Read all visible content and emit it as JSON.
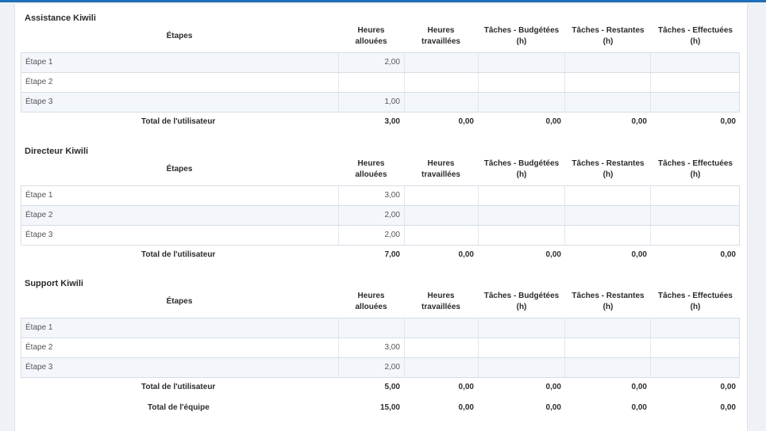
{
  "columns": {
    "etapes": "Étapes",
    "heures_allouees": "Heures\nallouées",
    "heures_travaillees": "Heures\ntravaillées",
    "taches_budgetees": "Tâches - Budgétées\n(h)",
    "taches_restantes": "Tâches - Restantes\n(h)",
    "taches_effectuees": "Tâches - Effectuées\n(h)"
  },
  "sections": [
    {
      "title": "Assistance Kiwili",
      "rows": [
        {
          "etape": "Étape 1",
          "heures_allouees": "2,00",
          "heures_travaillees": "",
          "taches_budgetees": "",
          "taches_restantes": "",
          "taches_effectuees": ""
        },
        {
          "etape": "Étape 2",
          "heures_allouees": "",
          "heures_travaillees": "",
          "taches_budgetees": "",
          "taches_restantes": "",
          "taches_effectuees": ""
        },
        {
          "etape": "Étape 3",
          "heures_allouees": "1,00",
          "heures_travaillees": "",
          "taches_budgetees": "",
          "taches_restantes": "",
          "taches_effectuees": ""
        }
      ],
      "total": {
        "label": "Total de l'utilisateur",
        "heures_allouees": "3,00",
        "heures_travaillees": "0,00",
        "taches_budgetees": "0,00",
        "taches_restantes": "0,00",
        "taches_effectuees": "0,00"
      }
    },
    {
      "title": "Directeur Kiwili",
      "rows": [
        {
          "etape": "Étape 1",
          "heures_allouees": "3,00",
          "heures_travaillees": "",
          "taches_budgetees": "",
          "taches_restantes": "",
          "taches_effectuees": ""
        },
        {
          "etape": "Étape 2",
          "heures_allouees": "2,00",
          "heures_travaillees": "",
          "taches_budgetees": "",
          "taches_restantes": "",
          "taches_effectuees": ""
        },
        {
          "etape": "Étape 3",
          "heures_allouees": "2,00",
          "heures_travaillees": "",
          "taches_budgetees": "",
          "taches_restantes": "",
          "taches_effectuees": ""
        }
      ],
      "total": {
        "label": "Total de l'utilisateur",
        "heures_allouees": "7,00",
        "heures_travaillees": "0,00",
        "taches_budgetees": "0,00",
        "taches_restantes": "0,00",
        "taches_effectuees": "0,00"
      }
    },
    {
      "title": "Support Kiwili",
      "rows": [
        {
          "etape": "Étape 1",
          "heures_allouees": "",
          "heures_travaillees": "",
          "taches_budgetees": "",
          "taches_restantes": "",
          "taches_effectuees": ""
        },
        {
          "etape": "Étape 2",
          "heures_allouees": "3,00",
          "heures_travaillees": "",
          "taches_budgetees": "",
          "taches_restantes": "",
          "taches_effectuees": ""
        },
        {
          "etape": "Étape 3",
          "heures_allouees": "2,00",
          "heures_travaillees": "",
          "taches_budgetees": "",
          "taches_restantes": "",
          "taches_effectuees": ""
        }
      ],
      "total": {
        "label": "Total de l'utilisateur",
        "heures_allouees": "5,00",
        "heures_travaillees": "0,00",
        "taches_budgetees": "0,00",
        "taches_restantes": "0,00",
        "taches_effectuees": "0,00"
      }
    }
  ],
  "team_total": {
    "label": "Total de l'équipe",
    "heures_allouees": "15,00",
    "heures_travaillees": "0,00",
    "taches_budgetees": "0,00",
    "taches_restantes": "0,00",
    "taches_effectuees": "0,00"
  }
}
